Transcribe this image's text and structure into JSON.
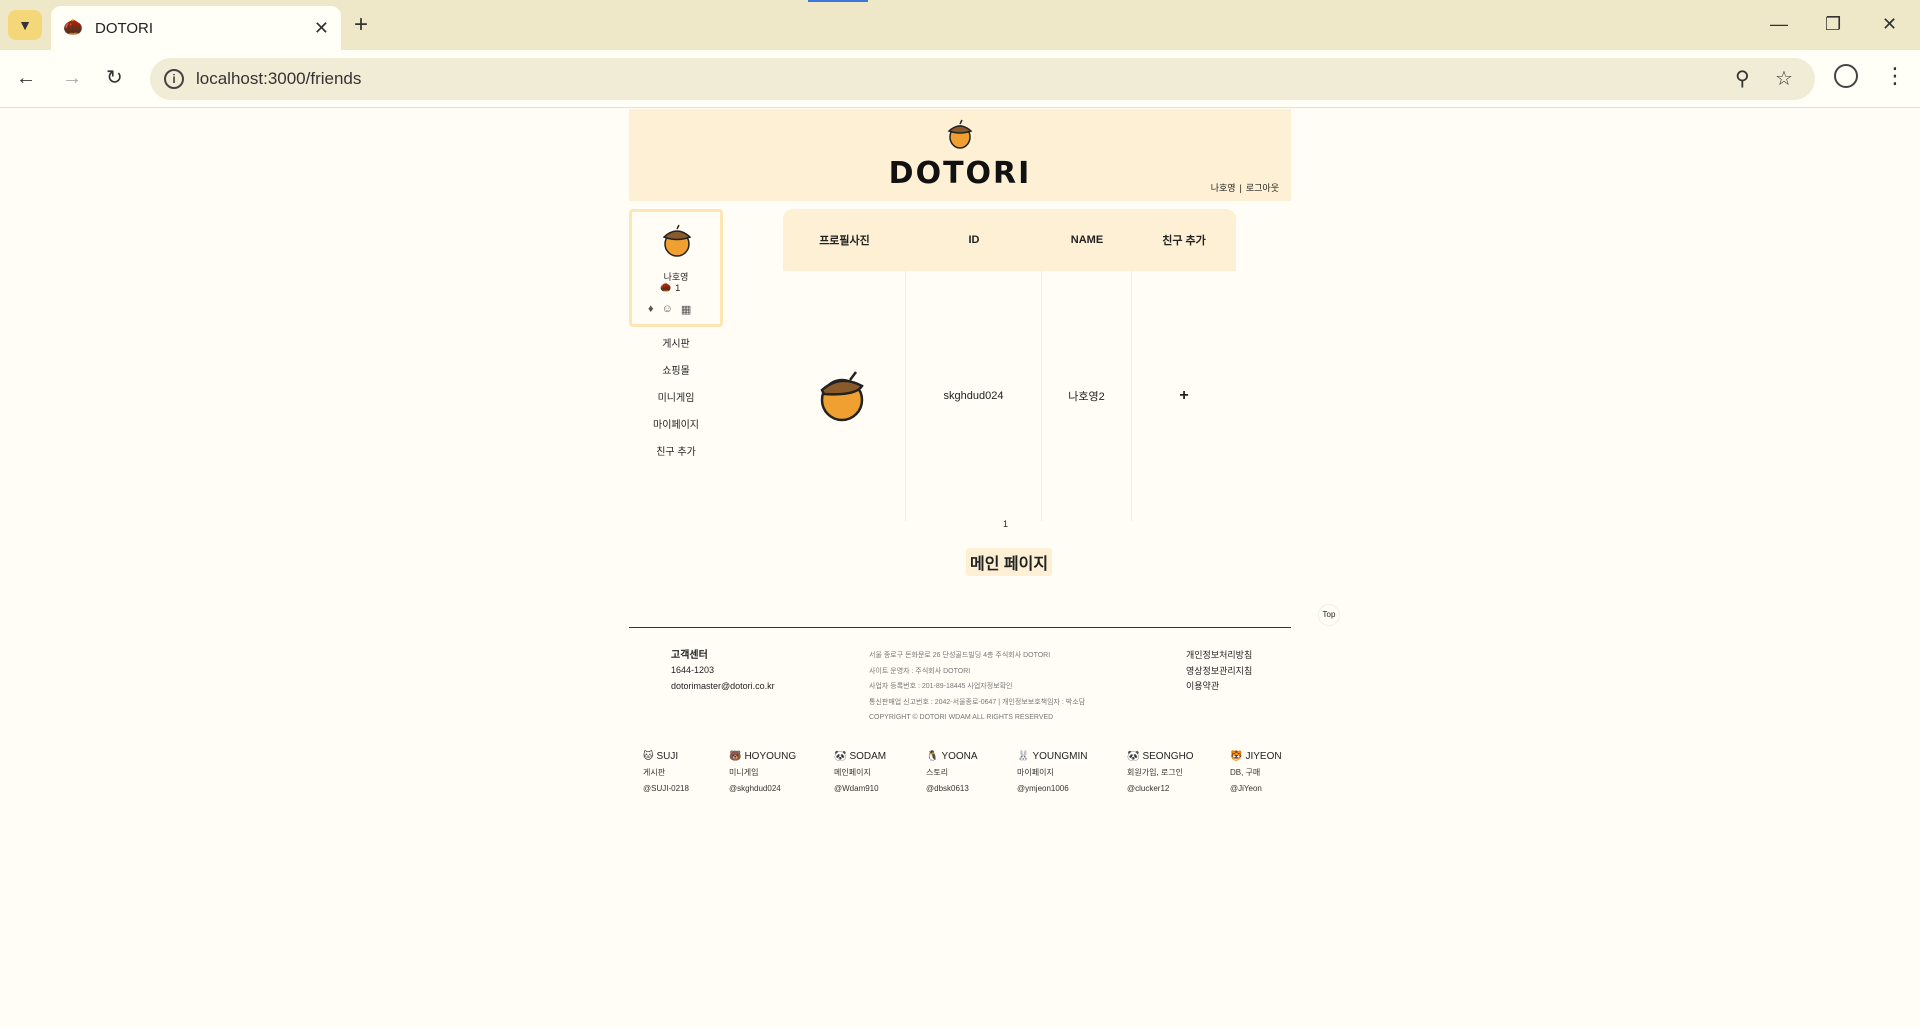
{
  "browser": {
    "tab_title": "DOTORI",
    "url": "localhost:3000/friends"
  },
  "header": {
    "logo_text": "DOTORI",
    "user_name": "나호영",
    "separator": "|",
    "logout": "로그아웃"
  },
  "profile": {
    "name": "나호영",
    "points": "1"
  },
  "sidebar": {
    "items": [
      {
        "label": "게시판"
      },
      {
        "label": "쇼핑몰"
      },
      {
        "label": "미니게임"
      },
      {
        "label": "마이페이지"
      },
      {
        "label": "친구 추가"
      }
    ]
  },
  "table": {
    "headers": [
      "프로필사진",
      "ID",
      "NAME",
      "친구 추가"
    ],
    "rows": [
      {
        "id": "skghdud024",
        "name": "나호영2",
        "action": "+"
      }
    ]
  },
  "pagination": {
    "current": "1"
  },
  "main_link": "메인 페이지",
  "top_button": "Top",
  "footer": {
    "cs_title": "고객센터",
    "cs_phone": "1644-1203",
    "cs_email": "dotorimaster@dotori.co.kr",
    "company_lines": [
      "서울 종로구 돈화문로 26 단성골드빌딩 4층 주식회사 DOTORI",
      "사이트 운영자 : 주식회사 DOTORI",
      "사업자 등록번호 : 201-89-18445 사업자정보확인",
      "통신판매업 신고번호 : 2042-서울종로-0647 | 개인정보보호책임자 : 박소담",
      "COPYRIGHT © DOTORI WDAM ALL RIGHTS RESERVED"
    ],
    "policy_links": [
      "개인정보처리방침",
      "영상정보관리지침",
      "이용약관"
    ]
  },
  "members": [
    {
      "icon": "cat-icon",
      "glyph": "🐱",
      "name": "SUJI",
      "role": "게시판",
      "handle": "@SUJI-0218"
    },
    {
      "icon": "bear-icon",
      "glyph": "🐻",
      "name": "HOYOUNG",
      "role": "미니게임",
      "handle": "@skghdud024"
    },
    {
      "icon": "raccoon-icon",
      "glyph": "🐼",
      "name": "SODAM",
      "role": "메인페이지",
      "handle": "@Wdam910"
    },
    {
      "icon": "penguin-icon",
      "glyph": "🐧",
      "name": "YOONA",
      "role": "스토리",
      "handle": "@dbsk0613"
    },
    {
      "icon": "rabbit-icon",
      "glyph": "🐰",
      "name": "YOUNGMIN",
      "role": "마이페이지",
      "handle": "@ymjeon1006"
    },
    {
      "icon": "panda-icon",
      "glyph": "🐼",
      "name": "SEONGHO",
      "role": "회원가입, 로그인",
      "handle": "@clucker12"
    },
    {
      "icon": "tiger-icon",
      "glyph": "🐯",
      "name": "JIYEON",
      "role": "DB, 구매",
      "handle": "@JiYeon"
    }
  ],
  "colors": {
    "page_bg": "#fffdf6",
    "header_bg": "#fdf0d4",
    "chrome_bg": "#eee8c8",
    "acorn_body": "#f0a030",
    "acorn_cap": "#8a5a2b"
  }
}
